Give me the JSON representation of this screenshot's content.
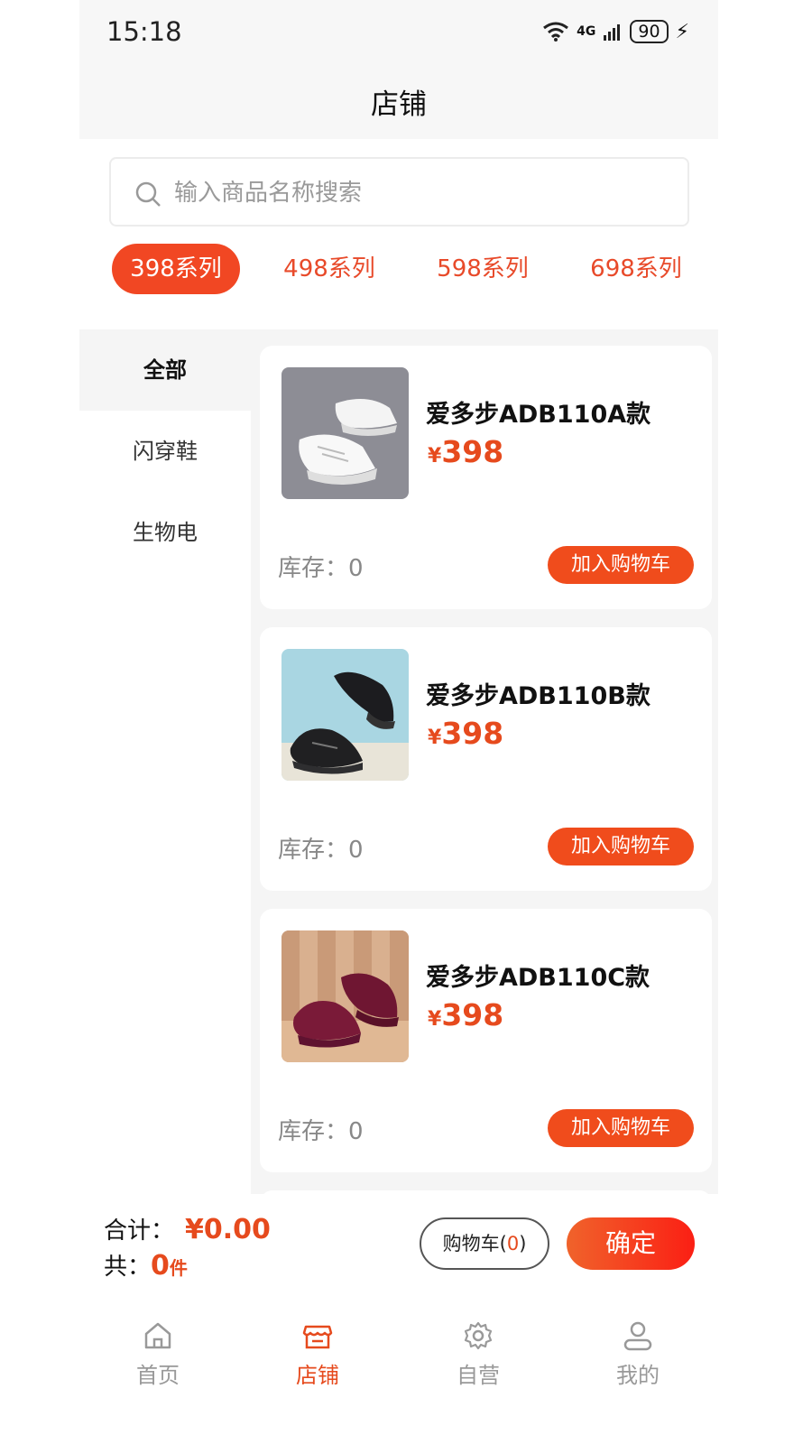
{
  "status_bar": {
    "time": "15:18",
    "network": "4G",
    "battery": "90"
  },
  "header": {
    "title": "店铺"
  },
  "search": {
    "placeholder": "输入商品名称搜索"
  },
  "series_tabs": [
    {
      "label": "398系列",
      "active": true
    },
    {
      "label": "498系列",
      "active": false
    },
    {
      "label": "598系列",
      "active": false
    },
    {
      "label": "698系列",
      "active": false
    }
  ],
  "categories": [
    {
      "label": "全部",
      "active": true
    },
    {
      "label": "闪穿鞋",
      "active": false
    },
    {
      "label": "生物电",
      "active": false
    }
  ],
  "products": [
    {
      "name": "爱多步ADB110A款",
      "currency": "¥",
      "price": "398",
      "stock": "库存：0",
      "add_to_cart": "加入购物车",
      "image_icon": "white-sneaker-photo"
    },
    {
      "name": "爱多步ADB110B款",
      "currency": "¥",
      "price": "398",
      "stock": "库存：0",
      "add_to_cart": "加入购物车",
      "image_icon": "black-sneaker-photo"
    },
    {
      "name": "爱多步ADB110C款",
      "currency": "¥",
      "price": "398",
      "stock": "库存：0",
      "add_to_cart": "加入购物车",
      "image_icon": "burgundy-sneaker-photo"
    }
  ],
  "footer": {
    "total_label": "合计：",
    "total_amount": "¥0.00",
    "count_label": "共：",
    "count_value": "0",
    "count_unit": "件",
    "cart_label": "购物车(",
    "cart_count": "0",
    "cart_close": ")",
    "confirm_label": "确定"
  },
  "tabbar": [
    {
      "label": "首页",
      "icon": "home-icon",
      "active": false
    },
    {
      "label": "店铺",
      "icon": "store-icon",
      "active": true
    },
    {
      "label": "自营",
      "icon": "gear-icon",
      "active": false
    },
    {
      "label": "我的",
      "icon": "user-icon",
      "active": false
    }
  ],
  "colors": {
    "accent": "#e64a1d",
    "active_tab_bg": "#f14723",
    "page_bg": "#f5f5f5"
  }
}
